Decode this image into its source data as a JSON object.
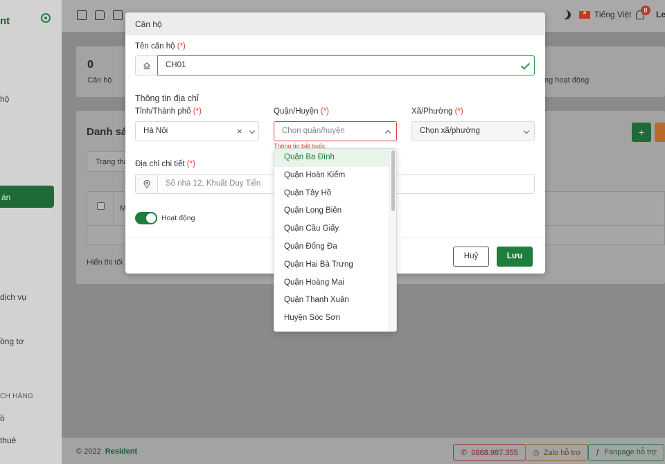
{
  "sidebar": {
    "logo_text": "nt",
    "items": [
      "hộ",
      "án",
      "dịch vụ",
      "ồng tơ",
      "ồ",
      "thuê"
    ],
    "section_label": "CH HÀNG"
  },
  "topbar": {
    "language": "Tiếng Việt",
    "notification_count": "8",
    "user_initials": "Le"
  },
  "background": {
    "stat_value": "0",
    "stat_label": "Căn hộ",
    "stat_label_2": "ng hoạt động",
    "list_title": "Danh sác",
    "filter_label": "Trạng thá",
    "table_header_initial": "M",
    "pagination_text": "Hiển thị tối",
    "add_icon": "+"
  },
  "modal": {
    "title": "Căn hộ",
    "name_label": "Tên căn hộ",
    "required_mark": "(*)",
    "name_value": "CH01",
    "address_section": "Thông tin địa chỉ",
    "province_label": "Tỉnh/Thành phố",
    "province_value": "Hà Nội",
    "district_label": "Quận/Huyện",
    "district_placeholder": "Chọn quận/huyện",
    "district_error": "Thông tin bắt buộc",
    "ward_label": "Xã/Phường",
    "ward_placeholder": "Chọn xã/phường",
    "detail_label": "Địa chỉ chi tiết",
    "detail_placeholder": "Số nhà 12, Khuất Duy Tiến",
    "active_label": "Hoạt động",
    "cancel_label": "Huỷ",
    "save_label": "Lưu"
  },
  "dropdown": {
    "options": [
      "Quận Ba Đình",
      "Quận Hoàn Kiếm",
      "Quận Tây Hồ",
      "Quận Long Biên",
      "Quận Cầu Giấy",
      "Quận Đống Đa",
      "Quận Hai Bà Trưng",
      "Quận Hoàng Mai",
      "Quận Thanh Xuân",
      "Huyện Sóc Sơn"
    ],
    "selected_index": 0
  },
  "footer": {
    "copyright": "© 2022",
    "brand": "Resident",
    "phone": "0868.987.355",
    "zalo": "Zalo hỗ trợ",
    "fanpage": "Fanpage hỗ trợ"
  },
  "colors": {
    "primary": "#1e7e3e",
    "error": "#e53935",
    "valid": "#2e9e4f"
  }
}
